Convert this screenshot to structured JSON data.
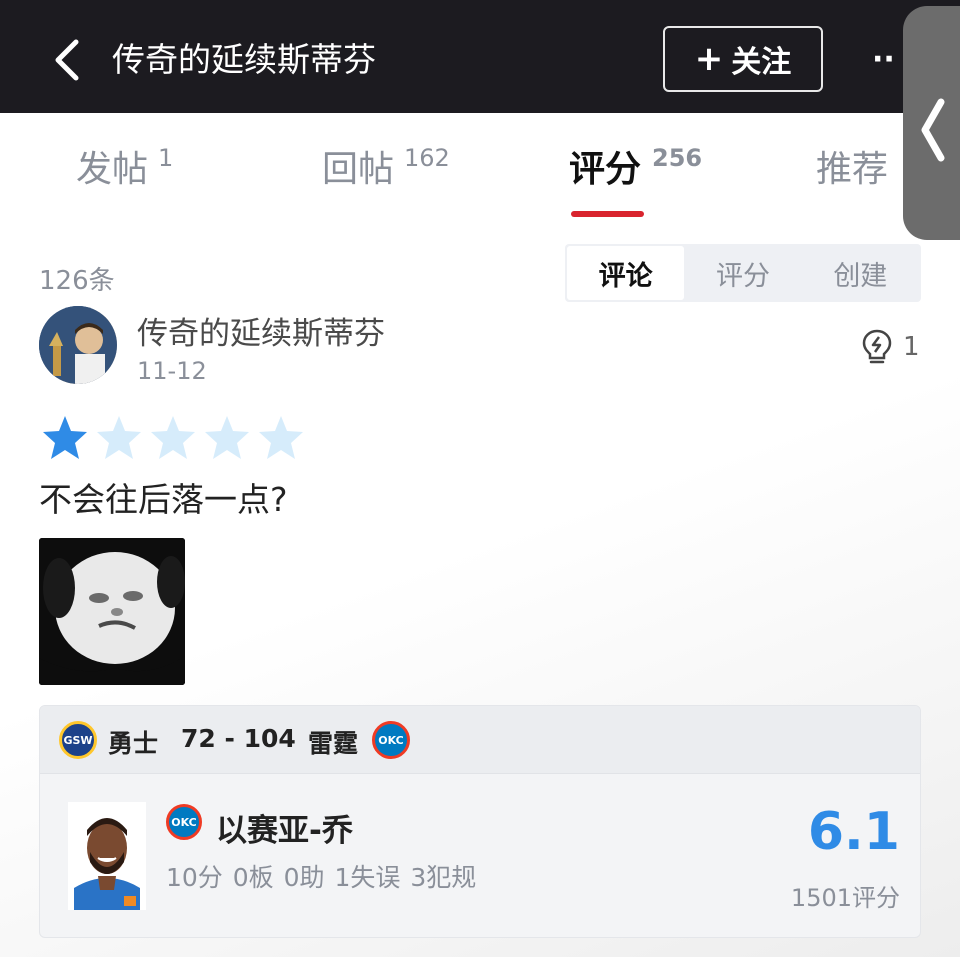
{
  "header": {
    "title": "传奇的延续斯蒂芬",
    "follow_plus": "+",
    "follow_label": "关注",
    "more_label": "··"
  },
  "tabs": [
    {
      "label": "发帖",
      "count": "1"
    },
    {
      "label": "回帖",
      "count": "162"
    },
    {
      "label": "评分",
      "count": "256",
      "active": true
    },
    {
      "label": "推荐",
      "count": ""
    }
  ],
  "list": {
    "count_label": "126条",
    "segments": [
      "评论",
      "评分",
      "创建"
    ],
    "active_segment": "评论"
  },
  "post": {
    "username": "传奇的延续斯蒂芬",
    "date": "11-12",
    "like_count": "1",
    "rating_stars": 1,
    "rating_max": 5,
    "comment": "不会往后落一点?"
  },
  "game": {
    "home_team": "勇士",
    "score": "72 - 104",
    "away_team": "雷霆",
    "home_logo_text": "GSW",
    "away_logo_text": "OKC",
    "player": {
      "name": "以赛亚-乔",
      "stats": "10分 0板 0助 1失误 3犯规",
      "rating": "6.1",
      "rating_count": "1501评分"
    }
  },
  "colors": {
    "header_bg": "#1c1b20",
    "tab_indicator": "#d9242e",
    "star_filled": "#2f8be6",
    "star_empty": "#d6ecfb",
    "rating_text": "#2f8be6"
  }
}
